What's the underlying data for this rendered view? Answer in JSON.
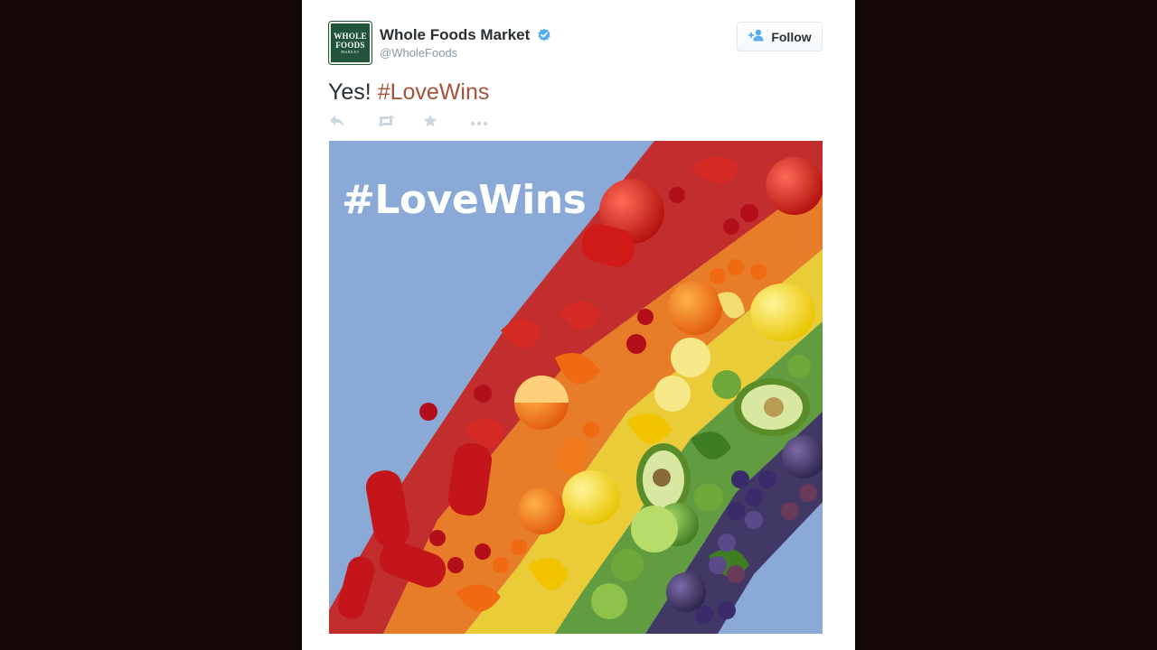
{
  "tweet": {
    "author": {
      "display_name": "Whole Foods Market",
      "handle": "@WholeFoods",
      "verified": true,
      "avatar_logo_lines": [
        "WHOLE",
        "FOODS",
        "MARKET"
      ],
      "avatar_color": "#21543a"
    },
    "follow_button": {
      "label": "Follow",
      "icon": "add-user-icon"
    },
    "text": {
      "prefix": "Yes!",
      "hashtag": "#LoveWins"
    },
    "actions": [
      {
        "name": "reply",
        "icon": "reply-icon"
      },
      {
        "name": "retweet",
        "icon": "retweet-icon"
      },
      {
        "name": "favorite",
        "icon": "star-icon"
      },
      {
        "name": "more",
        "icon": "more-icon"
      }
    ],
    "media": {
      "overlay_text": "#LoveWins",
      "background_color": "#8aa9d6"
    }
  },
  "colors": {
    "page_background": "#150607",
    "hashtag": "#a5533b",
    "verified": "#55acee",
    "muted_icon": "#ccd6dd"
  }
}
